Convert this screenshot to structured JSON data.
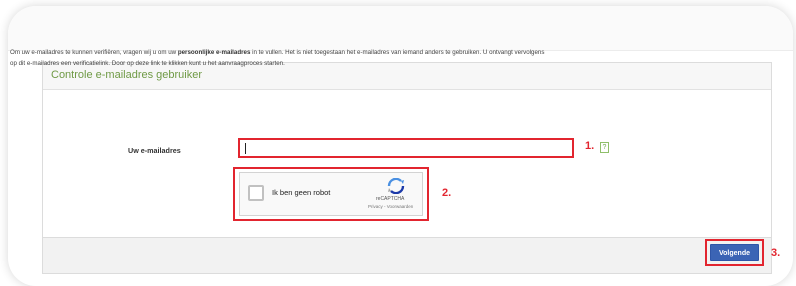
{
  "panel": {
    "title": "Controle e-mailadres gebruiker"
  },
  "intro": {
    "line1_a": "Om uw e-mailadres te kunnen verifiëren, vragen wij u om uw ",
    "line1_bold": "persoonlijke e-mailadres",
    "line1_b": " in te vullen. Het is niet toegestaan het e-mailadres van iemand anders te gebruiken. U ontvangt vervolgens",
    "line2": "op dit e-mailadres een verificatielink. Door op deze link te klikken kunt u het aanvraagproces starten."
  },
  "form": {
    "email_label": "Uw e-mailadres",
    "email_value": "",
    "help_icon": "?"
  },
  "captcha": {
    "label": "Ik ben geen robot",
    "brand": "reCAPTCHA",
    "links": "Privacy - Voorwaarden",
    "checked": false
  },
  "buttons": {
    "next_label": "Volgende"
  },
  "annotations": {
    "step1": "1.",
    "step2": "2.",
    "step3": "3."
  },
  "colors": {
    "highlight": "#e2252f",
    "title_green": "#6f9a45",
    "button_blue": "#3b64b5"
  }
}
